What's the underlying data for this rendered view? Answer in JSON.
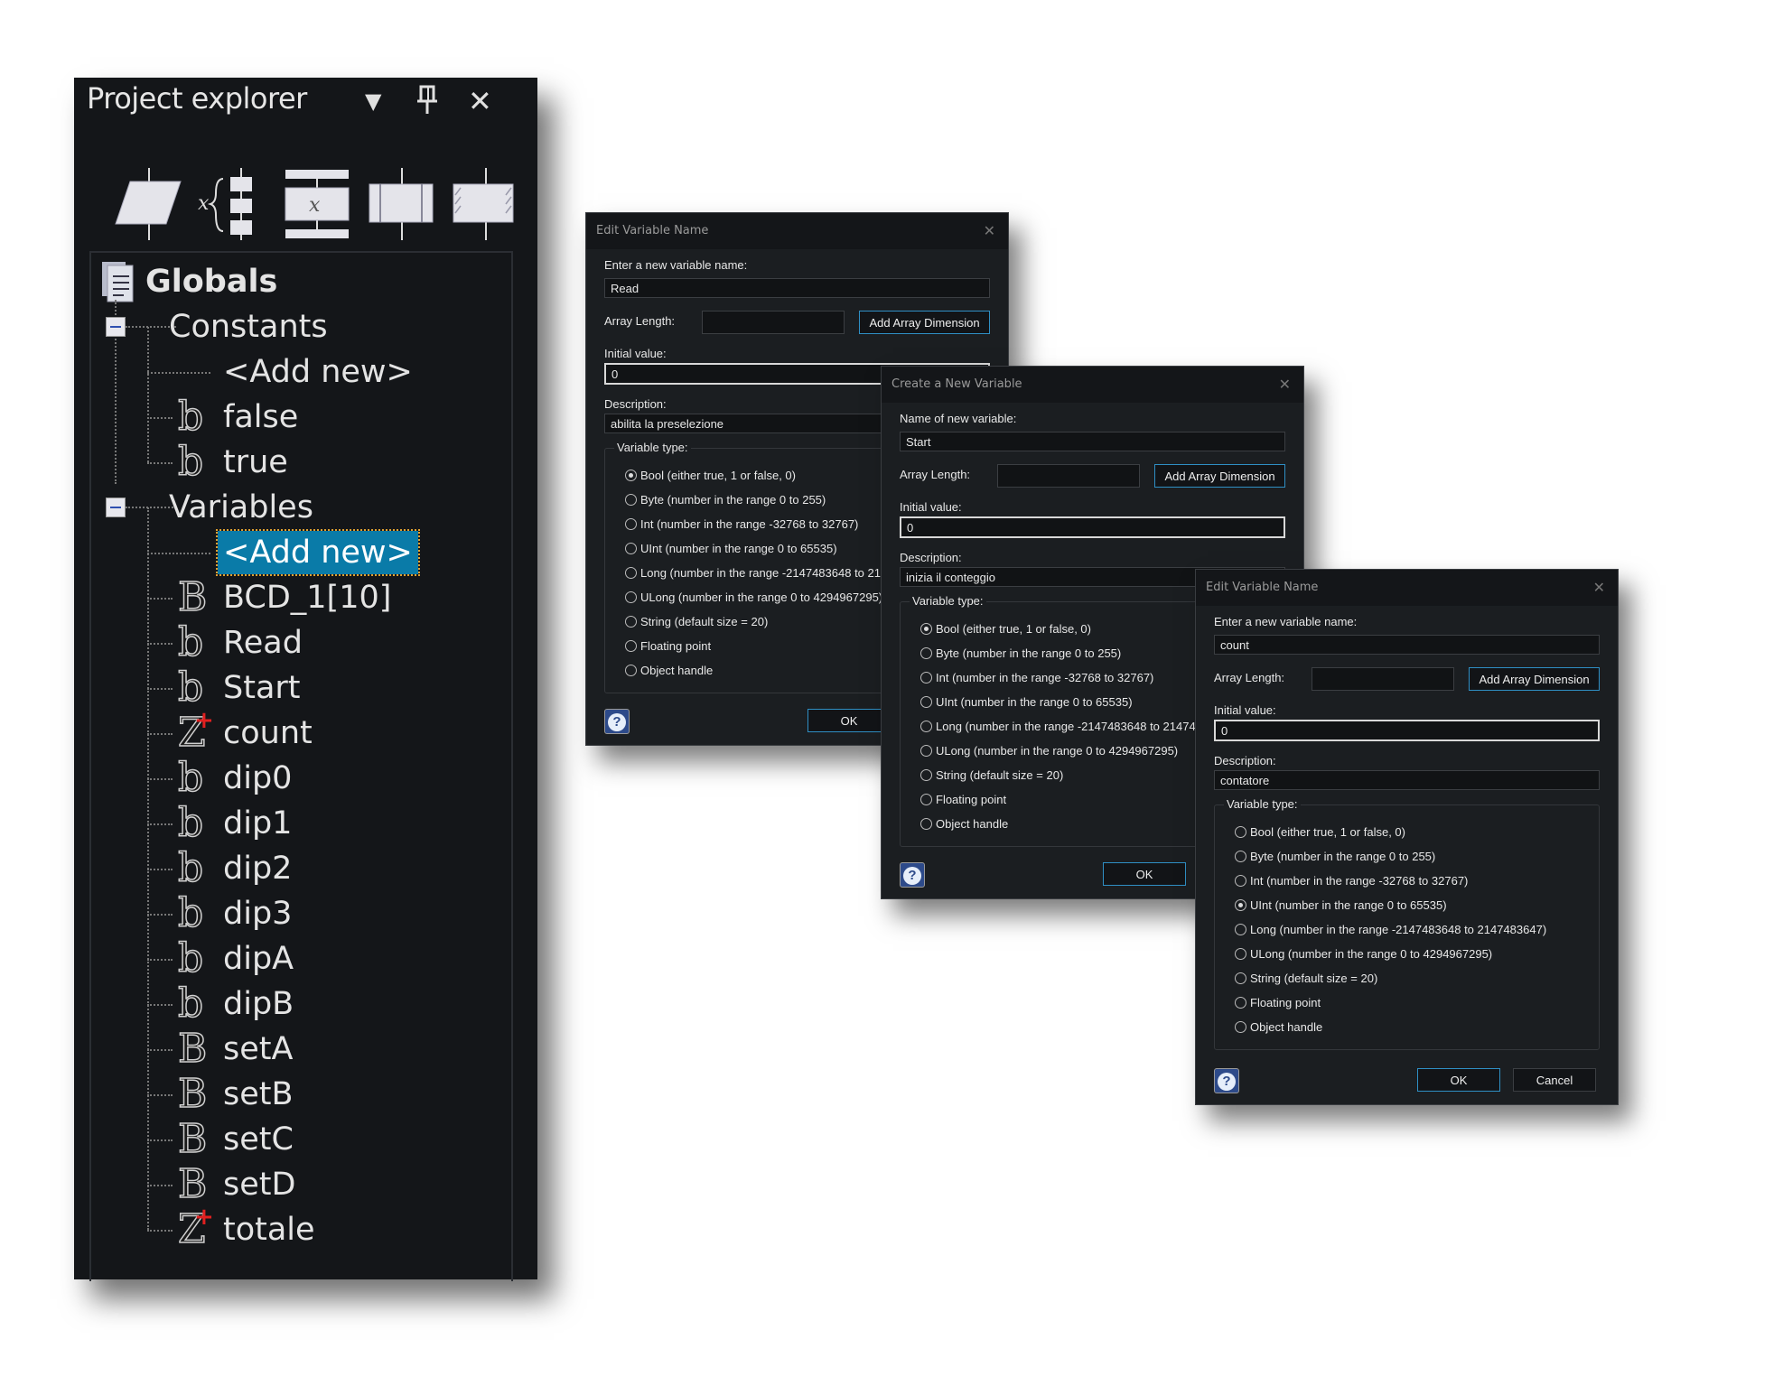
{
  "explorer": {
    "title": "Project explorer",
    "menu_icon": "▼",
    "pin_icon": "pin-icon",
    "close_icon": "✕",
    "toolbar": [
      "parallelogram-block-icon",
      "switch-case-icon",
      "assignment-block-icon",
      "subroutine-block-icon",
      "hatched-block-icon"
    ],
    "tree": {
      "root": "Globals",
      "constants": {
        "label": "Constants",
        "items": [
          {
            "name": "<Add new>",
            "icon": ""
          },
          {
            "name": "false",
            "icon": "b"
          },
          {
            "name": "true",
            "icon": "b"
          }
        ]
      },
      "variables": {
        "label": "Variables",
        "items": [
          {
            "name": "<Add new>",
            "icon": "",
            "selected": true
          },
          {
            "name": "BCD_1[10]",
            "icon": "B"
          },
          {
            "name": "Read",
            "icon": "b"
          },
          {
            "name": "Start",
            "icon": "b"
          },
          {
            "name": "count",
            "icon": "Z"
          },
          {
            "name": "dip0",
            "icon": "b"
          },
          {
            "name": "dip1",
            "icon": "b"
          },
          {
            "name": "dip2",
            "icon": "b"
          },
          {
            "name": "dip3",
            "icon": "b"
          },
          {
            "name": "dipA",
            "icon": "b"
          },
          {
            "name": "dipB",
            "icon": "b"
          },
          {
            "name": "setA",
            "icon": "B"
          },
          {
            "name": "setB",
            "icon": "B"
          },
          {
            "name": "setC",
            "icon": "B"
          },
          {
            "name": "setD",
            "icon": "B"
          },
          {
            "name": "totale",
            "icon": "Z"
          }
        ]
      }
    }
  },
  "dialogs": [
    {
      "title": "Edit Variable Name",
      "name_label": "Enter a new variable name:",
      "name_value": "Read",
      "array_label": "Array Length:",
      "array_value": "",
      "add_dim": "Add Array Dimension",
      "init_label": "Initial value:",
      "init_value": "0",
      "desc_label": "Description:",
      "desc_value": "abilita la preselezione",
      "type_label": "Variable type:",
      "selected": 0,
      "ok": "OK"
    },
    {
      "title": "Create a New Variable",
      "name_label": "Name of new variable:",
      "name_value": "Start",
      "array_label": "Array Length:",
      "array_value": "",
      "add_dim": "Add Array Dimension",
      "init_label": "Initial value:",
      "init_value": "0",
      "desc_label": "Description:",
      "desc_value": "inizia il conteggio",
      "type_label": "Variable type:",
      "selected": 0,
      "ok": "OK"
    },
    {
      "title": "Edit Variable Name",
      "name_label": "Enter a new variable name:",
      "name_value": "count",
      "array_label": "Array Length:",
      "array_value": "",
      "add_dim": "Add Array Dimension",
      "init_label": "Initial value:",
      "init_value": "0",
      "desc_label": "Description:",
      "desc_value": "contatore",
      "type_label": "Variable type:",
      "selected": 3,
      "ok": "OK",
      "cancel": "Cancel"
    }
  ],
  "variable_types": [
    "Bool (either true, 1 or false, 0)",
    "Byte (number in the range 0 to 255)",
    "Int (number in the range -32768 to 32767)",
    "UInt (number in the range 0 to 65535)",
    "Long (number in the range -2147483648 to 2147483647)",
    "ULong (number in the range 0 to 4294967295)",
    "String (default size = 20)",
    "Floating point",
    "Object handle"
  ],
  "colors": {
    "selection": "#0a7ba8",
    "accent_border": "#2f8fc4",
    "uint_marker": "#e02020"
  }
}
